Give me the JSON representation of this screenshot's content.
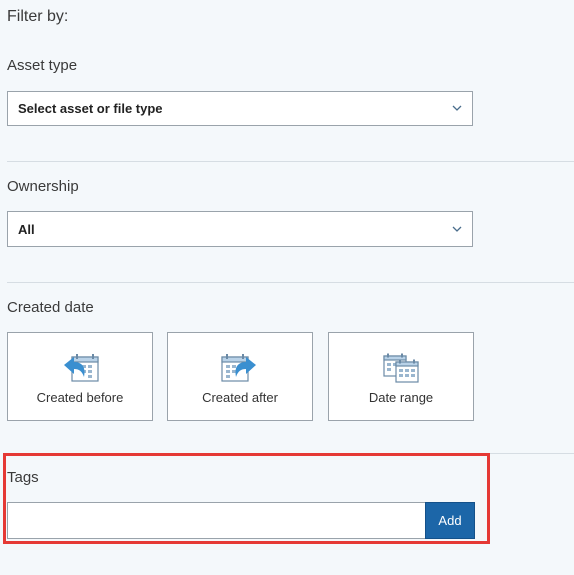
{
  "filter": {
    "heading": "Filter by:",
    "asset_type": {
      "label": "Asset type",
      "selected": "Select asset or file type",
      "chevron_icon": "chevron-down-icon"
    },
    "ownership": {
      "label": "Ownership",
      "selected": "All",
      "chevron_icon": "chevron-down-icon"
    },
    "created_date": {
      "label": "Created date",
      "options": [
        {
          "label": "Created before",
          "icon": "calendar-arrow-left-icon"
        },
        {
          "label": "Created after",
          "icon": "calendar-arrow-right-icon"
        },
        {
          "label": "Date range",
          "icon": "calendar-range-icon"
        }
      ]
    },
    "tags": {
      "label": "Tags",
      "input_value": "",
      "input_placeholder": "",
      "add_label": "Add"
    }
  },
  "colors": {
    "background": "#f4f8fb",
    "accent": "#1c66a8",
    "icon_blue": "#3a8fd0",
    "highlight": "#e53935"
  }
}
